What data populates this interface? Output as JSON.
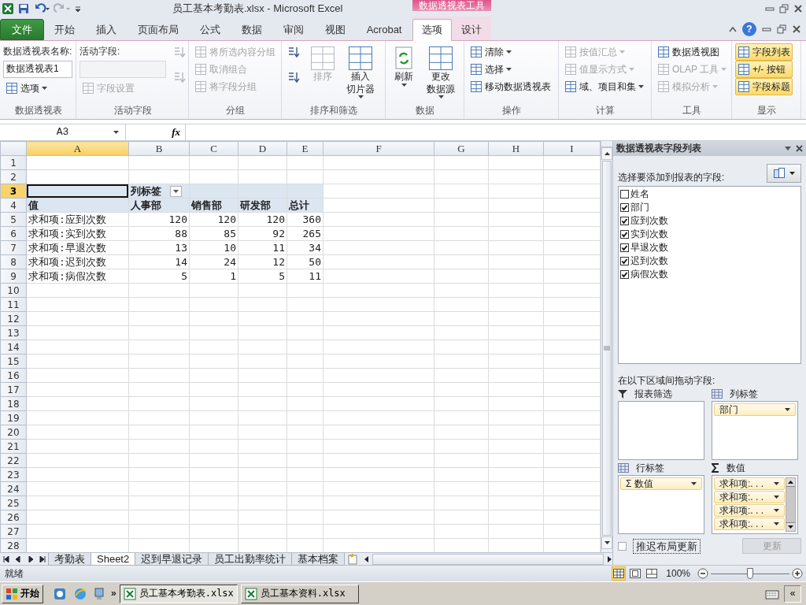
{
  "window": {
    "title": "员工基本考勤表.xlsx  -  Microsoft Excel"
  },
  "contextual_tab_group": {
    "label": "数据透视表工具"
  },
  "help_button": {
    "label": "?"
  },
  "file_tab": {
    "label": "文件"
  },
  "tabs": [
    {
      "label": "开始",
      "selected": false,
      "contextual": false
    },
    {
      "label": "插入",
      "selected": false,
      "contextual": false
    },
    {
      "label": "页面布局",
      "selected": false,
      "contextual": false
    },
    {
      "label": "公式",
      "selected": false,
      "contextual": false
    },
    {
      "label": "数据",
      "selected": false,
      "contextual": false
    },
    {
      "label": "审阅",
      "selected": false,
      "contextual": false
    },
    {
      "label": "视图",
      "selected": false,
      "contextual": false
    },
    {
      "label": "Acrobat",
      "selected": false,
      "contextual": false
    },
    {
      "label": "选项",
      "selected": true,
      "contextual": true
    },
    {
      "label": "设计",
      "selected": false,
      "contextual": true
    }
  ],
  "ribbon_groups": [
    {
      "label": "数据透视表",
      "items": [
        {
          "kind": "label",
          "label": "数据透视表名称:",
          "disabled": false
        },
        {
          "kind": "input",
          "value": "数据透视表1",
          "disabled": false
        },
        {
          "kind": "small",
          "label": "选项",
          "dropdown": true,
          "disabled": false
        }
      ]
    },
    {
      "label": "活动字段",
      "items": [
        {
          "kind": "label",
          "label": "活动字段:",
          "disabled": false
        },
        {
          "kind": "input",
          "disabled": true
        },
        {
          "kind": "small",
          "label": "字段设置",
          "dropdown": false,
          "disabled": true
        },
        {
          "kind": "icon",
          "disabled": true
        },
        {
          "kind": "icon",
          "disabled": true
        }
      ]
    },
    {
      "label": "分组",
      "items": [
        {
          "kind": "small",
          "label": "将所选内容分组",
          "dropdown": false,
          "disabled": true
        },
        {
          "kind": "small",
          "label": "取消组合",
          "dropdown": false,
          "disabled": true
        },
        {
          "kind": "small",
          "label": "将字段分组",
          "dropdown": false,
          "disabled": true
        }
      ]
    },
    {
      "label": "排序和筛选",
      "items": [
        {
          "kind": "icon",
          "disabled": false
        },
        {
          "kind": "icon",
          "disabled": false
        },
        {
          "kind": "large",
          "lines": [
            "排序"
          ],
          "dropdown": false,
          "disabled": true
        },
        {
          "kind": "large",
          "lines": [
            "插入",
            "切片器"
          ],
          "dropdown": true,
          "disabled": false
        }
      ]
    },
    {
      "label": "数据",
      "items": [
        {
          "kind": "large",
          "lines": [
            "刷新"
          ],
          "dropdown": true,
          "disabled": false
        },
        {
          "kind": "large",
          "lines": [
            "更改",
            "数据源"
          ],
          "dropdown": true,
          "disabled": false
        }
      ]
    },
    {
      "label": "操作",
      "items": [
        {
          "kind": "small",
          "label": "清除",
          "dropdown": true,
          "disabled": false
        },
        {
          "kind": "small",
          "label": "选择",
          "dropdown": true,
          "disabled": false
        },
        {
          "kind": "small",
          "label": "移动数据透视表",
          "dropdown": false,
          "disabled": false
        }
      ]
    },
    {
      "label": "计算",
      "items": [
        {
          "kind": "small",
          "label": "按值汇总",
          "dropdown": true,
          "disabled": true
        },
        {
          "kind": "small",
          "label": "值显示方式",
          "dropdown": true,
          "disabled": true
        },
        {
          "kind": "small",
          "label": "域、项目和集",
          "dropdown": true,
          "disabled": false
        }
      ]
    },
    {
      "label": "工具",
      "items": [
        {
          "kind": "small",
          "label": "数据透视图",
          "dropdown": false,
          "disabled": false
        },
        {
          "kind": "small",
          "label": "OLAP 工具",
          "dropdown": true,
          "disabled": true
        },
        {
          "kind": "small",
          "label": "模拟分析",
          "dropdown": true,
          "disabled": true
        }
      ]
    },
    {
      "label": "显示",
      "items": [
        {
          "kind": "toggle",
          "label": "字段列表",
          "on": true
        },
        {
          "kind": "toggle",
          "label": "+/- 按钮",
          "on": true
        },
        {
          "kind": "toggle",
          "label": "字段标题",
          "on": true
        }
      ]
    }
  ],
  "formula_bar": {
    "name_box": "A3",
    "function_label": "fx"
  },
  "sheet": {
    "columns": [
      {
        "label": "A",
        "selected": true
      },
      {
        "label": "B",
        "selected": false
      },
      {
        "label": "C",
        "selected": false
      },
      {
        "label": "D",
        "selected": false
      },
      {
        "label": "E",
        "selected": false
      },
      {
        "label": "F",
        "selected": false
      },
      {
        "label": "G",
        "selected": false
      },
      {
        "label": "H",
        "selected": false
      },
      {
        "label": "I",
        "selected": false
      }
    ],
    "rows": [
      {
        "label": "1",
        "selected": false
      },
      {
        "label": "2",
        "selected": false
      },
      {
        "label": "3",
        "selected": true
      },
      {
        "label": "4",
        "selected": false
      },
      {
        "label": "5",
        "selected": false
      },
      {
        "label": "6",
        "selected": false
      },
      {
        "label": "7",
        "selected": false
      },
      {
        "label": "8",
        "selected": false
      },
      {
        "label": "9",
        "selected": false
      },
      {
        "label": "10",
        "selected": false
      },
      {
        "label": "11",
        "selected": false
      },
      {
        "label": "12",
        "selected": false
      },
      {
        "label": "13",
        "selected": false
      },
      {
        "label": "14",
        "selected": false
      },
      {
        "label": "15",
        "selected": false
      },
      {
        "label": "16",
        "selected": false
      },
      {
        "label": "17",
        "selected": false
      },
      {
        "label": "18",
        "selected": false
      },
      {
        "label": "19",
        "selected": false
      },
      {
        "label": "20",
        "selected": false
      },
      {
        "label": "21",
        "selected": false
      },
      {
        "label": "22",
        "selected": false
      },
      {
        "label": "23",
        "selected": false
      },
      {
        "label": "24",
        "selected": false
      },
      {
        "label": "25",
        "selected": false
      },
      {
        "label": "26",
        "selected": false
      },
      {
        "label": "27",
        "selected": false
      },
      {
        "label": "28",
        "selected": false
      }
    ],
    "pivot": {
      "column_labels_header": "列标签",
      "values_header": "值",
      "columns": [
        "人事部",
        "销售部",
        "研发部",
        "总计"
      ],
      "rows": [
        {
          "label": "求和项:应到次数",
          "values": [
            "120",
            "120",
            "120",
            "360"
          ]
        },
        {
          "label": "求和项:实到次数",
          "values": [
            "88",
            "85",
            "92",
            "265"
          ]
        },
        {
          "label": "求和项:早退次数",
          "values": [
            "13",
            "10",
            "11",
            "34"
          ]
        },
        {
          "label": "求和项:迟到次数",
          "values": [
            "14",
            "24",
            "12",
            "50"
          ]
        },
        {
          "label": "求和项:病假次数",
          "values": [
            "5",
            "1",
            "5",
            "11"
          ]
        }
      ]
    }
  },
  "sheet_tabs": [
    {
      "label": "考勤表",
      "selected": false
    },
    {
      "label": "Sheet2",
      "selected": true
    },
    {
      "label": "迟到早退记录",
      "selected": false
    },
    {
      "label": "员工出勤率统计",
      "selected": false
    },
    {
      "label": "基本档案",
      "selected": false
    }
  ],
  "field_list": {
    "title": "数据透视表字段列表",
    "prompt": "选择要添加到报表的字段:",
    "fields": [
      {
        "label": "姓名",
        "checked": false
      },
      {
        "label": "部门",
        "checked": true
      },
      {
        "label": "应到次数",
        "checked": true
      },
      {
        "label": "实到次数",
        "checked": true
      },
      {
        "label": "早退次数",
        "checked": true
      },
      {
        "label": "迟到次数",
        "checked": true
      },
      {
        "label": "病假次数",
        "checked": true
      }
    ],
    "areas_prompt": "在以下区域间拖动字段:",
    "areas": [
      {
        "kind": "filter",
        "label": "报表筛选"
      },
      {
        "kind": "columns",
        "label": "列标签",
        "items": [
          {
            "label": "部门"
          }
        ]
      },
      {
        "kind": "rows",
        "label": "行标签",
        "items": [
          {
            "label": "Σ 数值"
          }
        ]
      },
      {
        "kind": "values",
        "label": "数值",
        "items": [
          {
            "label": "求和项:. . ."
          },
          {
            "label": "求和项:. . ."
          },
          {
            "label": "求和项:. . ."
          },
          {
            "label": "求和项:. . ."
          }
        ]
      }
    ],
    "defer_update": {
      "label": "推迟布局更新",
      "checked": false
    },
    "update_button": {
      "label": "更新",
      "disabled": true
    }
  },
  "status_bar": {
    "text": "就绪",
    "views": [
      {
        "kind": "normal",
        "selected": true
      },
      {
        "kind": "page_layout",
        "selected": false
      },
      {
        "kind": "page_break",
        "selected": false
      }
    ],
    "zoom": "100%",
    "zoom_slider": {
      "level": 0.5
    }
  },
  "taskbar": {
    "start": "开始",
    "overflow": "»",
    "tasks": [
      {
        "label": "员工基本考勤表.xlsx",
        "selected": true
      },
      {
        "label": "员工基本资料.xlsx",
        "selected": false
      }
    ],
    "collapse": "«"
  }
}
